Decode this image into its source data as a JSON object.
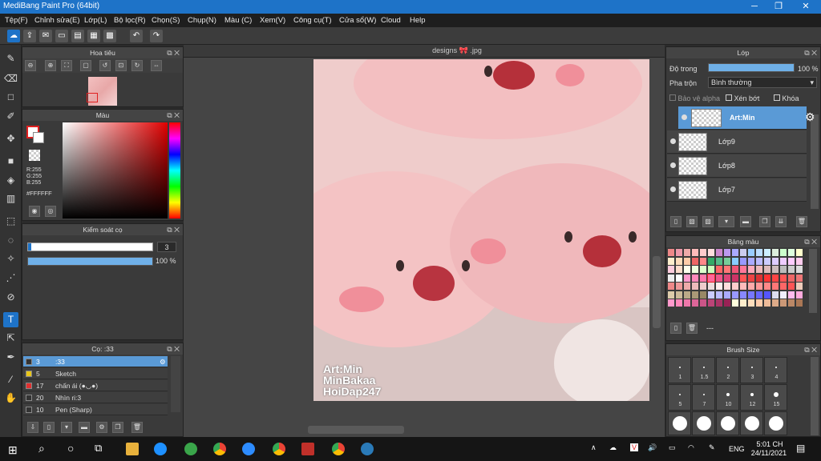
{
  "window": {
    "title": "MediBang Paint Pro (64bit)",
    "minimize": "─",
    "maximize": "❐",
    "close": "✕"
  },
  "menu": [
    "Tệp(F)",
    "Chỉnh sửa(E)",
    "Lớp(L)",
    "Bộ lọc(R)",
    "Chọn(S)",
    "Chụp(N)",
    "Màu (C)",
    "Xem(V)",
    "Công cụ(T)",
    "Cửa sổ(W)",
    "Cloud",
    "Help"
  ],
  "navigator": {
    "title": "Hoa tiêu"
  },
  "color_panel": {
    "title": "Màu",
    "r": "R:255",
    "g": "G:255",
    "b": "B:255",
    "hex": "#FFFFFF",
    "primary_color": "#ffffff",
    "secondary_color": "#ffffff"
  },
  "brush_control": {
    "title": "Kiểm soát cọ",
    "size_value": "3",
    "opacity_value": "100 %",
    "opacity_fill": 1.0
  },
  "brush_list": {
    "title": "Cọ: :33",
    "items": [
      {
        "num": "3",
        "name": ":33",
        "color": "#333333",
        "selected": true
      },
      {
        "num": "5",
        "name": "Sketch",
        "color": "#e8c619",
        "selected": false
      },
      {
        "num": "17",
        "name": "chấn ái (●◡●)",
        "color": "#e03030",
        "selected": false
      },
      {
        "num": "20",
        "name": "Nhìn ri:3",
        "color": "#333333",
        "selected": false
      },
      {
        "num": "10",
        "name": "Pen (Sharp)",
        "color": "#333333",
        "selected": false
      }
    ]
  },
  "canvas": {
    "tab": "designs 🎀 .jpg",
    "watermark_lines": [
      "Art:Min",
      "MinBakaa",
      "HoiDap247"
    ]
  },
  "layers": {
    "title": "Lớp",
    "opacity_label": "Độ trong",
    "opacity_value": "100 %",
    "opacity_fill": 1.0,
    "blend_label": "Pha trộn",
    "blend_value": "Bình thường",
    "protect_alpha": "Bảo vệ alpha",
    "clip": "Xén bớt",
    "lock": "Khóa",
    "items": [
      {
        "name": "Art:Min",
        "selected": true
      },
      {
        "name": "Lớp9",
        "selected": false
      },
      {
        "name": "Lớp8",
        "selected": false
      },
      {
        "name": "Lớp7",
        "selected": false
      }
    ]
  },
  "palette": {
    "title": "Bảng màu",
    "footer_text": "---"
  },
  "brush_size": {
    "title": "Brush Size",
    "sizes": [
      "1",
      "1.5",
      "2",
      "3",
      "4",
      "5",
      "7",
      "10",
      "12",
      "15"
    ]
  },
  "taskbar": {
    "lang": "ENG",
    "time": "5:01 CH",
    "date": "24/11/2021"
  }
}
